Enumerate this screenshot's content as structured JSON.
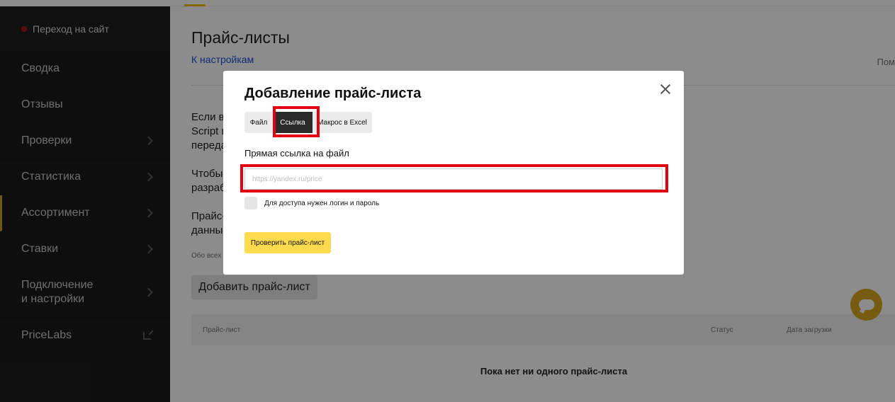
{
  "sidebar": {
    "site_link": "Переход на сайт",
    "items": [
      {
        "label": "Сводка"
      },
      {
        "label": "Отзывы"
      },
      {
        "label": "Проверки"
      },
      {
        "label": "Статистика"
      },
      {
        "label": "Ассортимент"
      },
      {
        "label": "Ставки"
      },
      {
        "label": "Подключение\nи настройки"
      },
      {
        "label": "PriceLabs"
      }
    ]
  },
  "main": {
    "title": "Прайс-листы",
    "back_link": "К настройкам",
    "top_right_text": "Пом",
    "paragraphs": [
      "Если в",
      "Script п",
      "переда",
      "Чтобы",
      "разраб",
      "Прайс-",
      "данны"
    ],
    "note": "Обо всех",
    "add_button": "Добавить прайс-лист",
    "table": {
      "columns": [
        "Прайс-лист",
        "Статус",
        "Дата загрузки"
      ],
      "empty_message": "Пока нет ни одного прайс-листа"
    }
  },
  "modal": {
    "title": "Добавление прайс-листа",
    "tabs": [
      {
        "label": "Файл"
      },
      {
        "label": "Ссылка"
      },
      {
        "label": "Макрос в Excel"
      }
    ],
    "active_tab": "Ссылка",
    "field_label": "Прямая ссылка на файл",
    "url_placeholder": "https://yandex.ru/price",
    "checkbox_label": "Для доступа нужен логин и пароль",
    "submit_button": "Проверить прайс-лист"
  },
  "colors": {
    "sidebar_bg": "#1b1b1b",
    "accent_yellow": "#ffdb4d",
    "highlight_red": "#e0000f",
    "link_blue": "#1a4fd6"
  }
}
